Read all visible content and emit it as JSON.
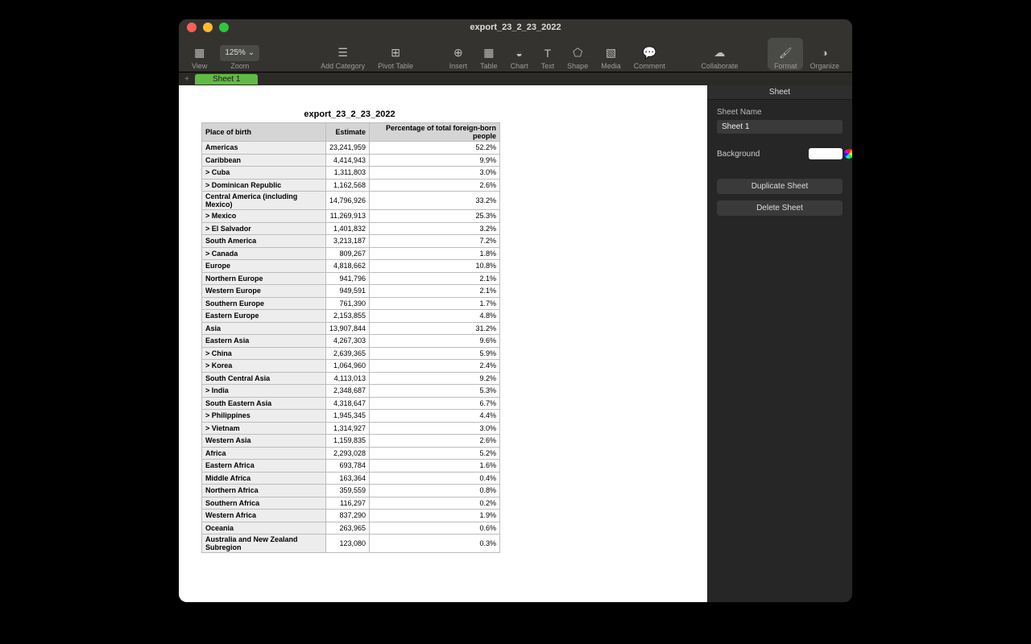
{
  "window": {
    "title": "export_23_2_23_2022"
  },
  "toolbar": {
    "view": "View",
    "zoom": "Zoom",
    "zoom_value": "125% ⌄",
    "add_category": "Add Category",
    "pivot": "Pivot Table",
    "insert": "Insert",
    "table": "Table",
    "chart": "Chart",
    "text": "Text",
    "shape": "Shape",
    "media": "Media",
    "comment": "Comment",
    "collaborate": "Collaborate",
    "format": "Format",
    "organize": "Organize"
  },
  "tabs": {
    "plus": "+",
    "sheet1": "Sheet 1"
  },
  "sheet": {
    "title": "export_23_2_23_2022",
    "headers": {
      "a": "Place of birth",
      "b": "Estimate",
      "c": "Percentage of total foreign-born people"
    },
    "rows": [
      {
        "a": "Americas",
        "b": "23,241,959",
        "c": "52.2%"
      },
      {
        "a": "Caribbean",
        "b": "4,414,943",
        "c": "9.9%"
      },
      {
        "a": "> Cuba",
        "b": "1,311,803",
        "c": "3.0%"
      },
      {
        "a": "> Dominican Republic",
        "b": "1,162,568",
        "c": "2.6%"
      },
      {
        "a": "Central America (including Mexico)",
        "b": "14,796,926",
        "c": "33.2%"
      },
      {
        "a": "> Mexico",
        "b": "11,269,913",
        "c": "25.3%"
      },
      {
        "a": "> El Salvador",
        "b": "1,401,832",
        "c": "3.2%"
      },
      {
        "a": "South America",
        "b": "3,213,187",
        "c": "7.2%"
      },
      {
        "a": "> Canada",
        "b": "809,267",
        "c": "1.8%"
      },
      {
        "a": "Europe",
        "b": "4,818,662",
        "c": "10.8%"
      },
      {
        "a": "Northern Europe",
        "b": "941,796",
        "c": "2.1%"
      },
      {
        "a": "Western Europe",
        "b": "949,591",
        "c": "2.1%"
      },
      {
        "a": "Southern Europe",
        "b": "761,390",
        "c": "1.7%"
      },
      {
        "a": "Eastern Europe",
        "b": "2,153,855",
        "c": "4.8%"
      },
      {
        "a": "Asia",
        "b": "13,907,844",
        "c": "31.2%"
      },
      {
        "a": "Eastern Asia",
        "b": "4,267,303",
        "c": "9.6%"
      },
      {
        "a": "> China",
        "b": "2,639,365",
        "c": "5.9%"
      },
      {
        "a": "> Korea",
        "b": "1,064,960",
        "c": "2.4%"
      },
      {
        "a": "South Central Asia",
        "b": "4,113,013",
        "c": "9.2%"
      },
      {
        "a": "> India",
        "b": "2,348,687",
        "c": "5.3%"
      },
      {
        "a": "South Eastern Asia",
        "b": "4,318,647",
        "c": "6.7%"
      },
      {
        "a": "> Philippines",
        "b": "1,945,345",
        "c": "4.4%"
      },
      {
        "a": "> Vietnam",
        "b": "1,314,927",
        "c": "3.0%"
      },
      {
        "a": "Western Asia",
        "b": "1,159,835",
        "c": "2.6%"
      },
      {
        "a": "Africa",
        "b": "2,293,028",
        "c": "5.2%"
      },
      {
        "a": "Eastern Africa",
        "b": "693,784",
        "c": "1.6%"
      },
      {
        "a": "Middle Africa",
        "b": "163,364",
        "c": "0.4%"
      },
      {
        "a": "Northern Africa",
        "b": "359,559",
        "c": "0.8%"
      },
      {
        "a": "Southern Africa",
        "b": "116,297",
        "c": "0.2%"
      },
      {
        "a": "Western Africa",
        "b": "837,290",
        "c": "1.9%"
      },
      {
        "a": "Oceania",
        "b": "263,965",
        "c": "0.6%"
      },
      {
        "a": "Australia and New Zealand Subregion",
        "b": "123,080",
        "c": "0.3%"
      }
    ]
  },
  "inspector": {
    "title": "Sheet",
    "name_label": "Sheet Name",
    "name_value": "Sheet 1",
    "background_label": "Background",
    "duplicate": "Duplicate Sheet",
    "delete": "Delete Sheet"
  },
  "icons": {
    "view": "▦",
    "add_category": "☰",
    "pivot": "⊞",
    "insert": "⊕",
    "table": "▦",
    "chart": "◒",
    "text": "T",
    "shape": "⬠",
    "media": "▧",
    "comment": "💬",
    "collaborate": "☁",
    "format": "🖌",
    "organize": "◑"
  }
}
